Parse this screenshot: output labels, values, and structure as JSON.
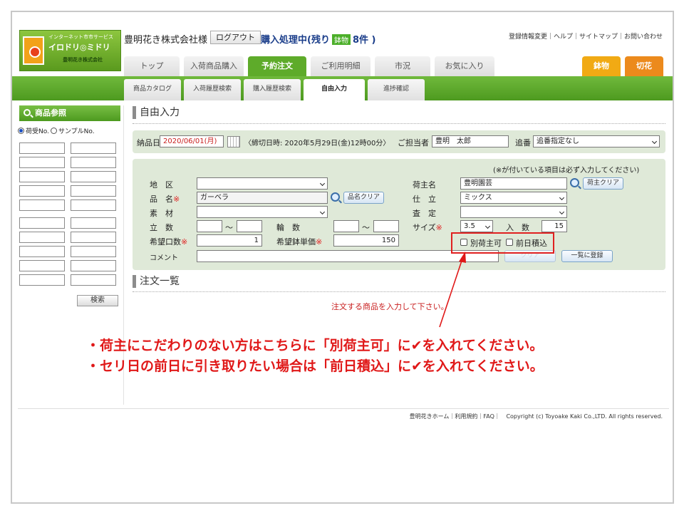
{
  "header": {
    "logo": {
      "tagline": "インターネット市市サービス",
      "name": "イロドリ◎ミドリ",
      "company": "豊明花き株式会社"
    },
    "company_label": "豊明花き株式会社様",
    "logout_label": "ログアウト",
    "status_prefix": "購入処理中(残り",
    "status_badge": "鉢物",
    "status_suffix": "8件 )",
    "top_links": "登録情報変更｜ヘルプ｜サイトマップ｜お問い合わせ"
  },
  "tabs": [
    {
      "label": "トップ"
    },
    {
      "label": "入荷商品購入"
    },
    {
      "label": "予約注文"
    },
    {
      "label": "ご利用明細"
    },
    {
      "label": "市況"
    },
    {
      "label": "お気に入り"
    },
    {
      "label": "鉢物"
    },
    {
      "label": "切花"
    }
  ],
  "subtabs": [
    {
      "label": "商品カタログ"
    },
    {
      "label": "入荷履歴検索"
    },
    {
      "label": "購入履歴検索"
    },
    {
      "label": "自由入力"
    },
    {
      "label": "進捗確認"
    }
  ],
  "sidebar": {
    "title": "商品参照",
    "radio1": "荷受No.",
    "radio2": "サンプルNo.",
    "search_label": "検索"
  },
  "free_input": {
    "title": "自由入力",
    "delivery_label": "納品日",
    "delivery_value": "2020/06/01(月)",
    "deadline_text": "〈締切日時: 2020年5月29日(金)12時00分〉",
    "staff_label": "ご担当者",
    "staff_value": "豊明　太郎",
    "order_no_label": "追番",
    "order_no_value": "追番指定なし"
  },
  "form": {
    "required_note": "(※が付いている項目は必ず入力してください)",
    "area_label": "地　区",
    "product_label": "品　名",
    "product_value": "ガーベラ",
    "product_clear": "品名クリア",
    "material_label": "素　材",
    "count_label": "立　数",
    "wheel_label": "輪　数",
    "tilde": "〜",
    "req_mark": "※",
    "desired_qty_label": "希望口数",
    "desired_qty_value": "1",
    "desired_price_label": "希望鉢単価",
    "desired_price_value": "150",
    "comment_label": "コメント",
    "shipper_label": "荷主名",
    "shipper_value": "豊明園芸",
    "shipper_clear": "荷主クリア",
    "finish_label": "仕　立",
    "finish_value": "ミックス",
    "grade_label": "査　定",
    "size_label": "サイズ",
    "size_value": "3.5",
    "pieces_label": "入　数",
    "pieces_value": "15",
    "other_shipper_label": "別荷主可",
    "prev_day_label": "前日積込",
    "clear_label": "クリア",
    "register_label": "一覧に登録"
  },
  "order_list": {
    "title": "注文一覧",
    "instruction": "注文する商品を入力して下さい。"
  },
  "annotations": {
    "line1": "・荷主にこだわりのない方はこちらに「別荷主可」に✔を入れてください。",
    "line2": "・セリ日の前日に引き取りたい場合は「前日積込」に✔を入れてください。"
  },
  "footer": {
    "links": "豊明花きホーム｜利用規約｜FAQ｜",
    "copyright": "Copyright (c) Toyoake Kaki Co.,LTD. All rights reserved."
  },
  "colors": {
    "green": "#5eab2a",
    "orange": "#ec8a1c",
    "red": "#e01818",
    "navy": "#1a3d8a"
  }
}
